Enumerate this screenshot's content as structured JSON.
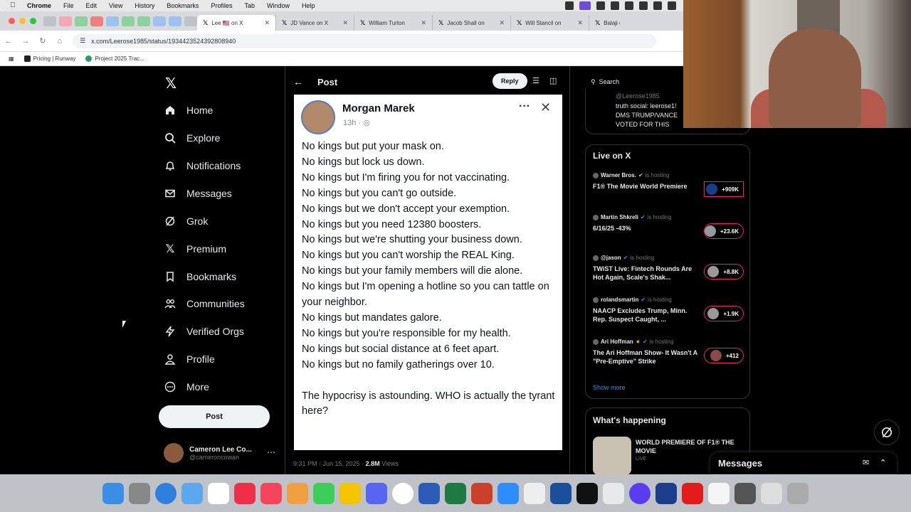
{
  "menubar": {
    "app": "Chrome",
    "items": [
      "File",
      "Edit",
      "View",
      "History",
      "Bookmarks",
      "Profiles",
      "Tab",
      "Window",
      "Help"
    ]
  },
  "tabs": [
    {
      "label": "Lee 🇺🇸 on X",
      "active": true
    },
    {
      "label": "JD Vance on X",
      "active": false
    },
    {
      "label": "William Turton",
      "active": false
    },
    {
      "label": "Jacob Shall on",
      "active": false
    },
    {
      "label": "Will Stancil on",
      "active": false
    },
    {
      "label": "Balaji on",
      "active": false
    }
  ],
  "address": {
    "url": "x.com/Leerose1985/status/1934423524392808940"
  },
  "bookmarks": [
    {
      "label": "Pricing | Runway",
      "color": "#222222"
    },
    {
      "label": "Project 2025 Trac...",
      "color": "#2e9e5b"
    }
  ],
  "nav": {
    "items": [
      {
        "label": "Home",
        "icon": "home-icon"
      },
      {
        "label": "Explore",
        "icon": "search-icon"
      },
      {
        "label": "Notifications",
        "icon": "bell-icon"
      },
      {
        "label": "Messages",
        "icon": "envelope-icon"
      },
      {
        "label": "Grok",
        "icon": "grok-icon"
      },
      {
        "label": "Premium",
        "icon": "x-icon"
      },
      {
        "label": "Bookmarks",
        "icon": "bookmark-icon"
      },
      {
        "label": "Communities",
        "icon": "people-icon"
      },
      {
        "label": "Verified Orgs",
        "icon": "lightning-icon"
      },
      {
        "label": "Profile",
        "icon": "person-icon"
      },
      {
        "label": "More",
        "icon": "more-circle-icon"
      }
    ],
    "post_label": "Post",
    "account": {
      "name": "Cameron Lee Co...",
      "handle": "@cameroncowan"
    }
  },
  "post": {
    "header_title": "Post",
    "reply_label": "Reply",
    "author": "Morgan Marek",
    "time": "13h",
    "lines": [
      "No kings but put your mask on.",
      "No kings but lock us down.",
      "No kings but I'm firing you for not vaccinating.",
      "No kings but you can't go outside.",
      "No kings but we don't accept your exemption.",
      "No kings but you need 12380 boosters.",
      "No kings but we're shutting your business down.",
      "No kings but you can't worship the REAL King.",
      "No kings but your family members will die alone.",
      "No kings but I'm opening a hotline so you can tattle on your neighbor.",
      "No kings but mandates galore.",
      "No kings but you're responsible for my health.",
      "No kings but social distance at 6 feet apart.",
      "No kings but no family gatherings over 10.",
      "",
      "The hypocrisy is astounding. WHO is actually the tyrant here?"
    ],
    "meta_date": "9:31 PM · Jun 15, 2025 ·",
    "meta_views": "2.8M",
    "meta_views_label": "Views"
  },
  "right": {
    "search_placeholder": "Search",
    "prev_handle": "@Leerose1985",
    "prev_lines": [
      "truth social: leerose1!",
      "DMS TRUMP/VANCE",
      "VOTED FOR THIS"
    ],
    "live_title": "Live on X",
    "is_hosting": "is hosting",
    "live_items": [
      {
        "host": "Warner Bros.",
        "title": "F1® The Movie World Premiere",
        "count": "+909K"
      },
      {
        "host": "Martin Shkreli",
        "title": "6/16/25 -43%",
        "count": "+23.6K"
      },
      {
        "host": "@jason",
        "title": "TWiST Live: Fintech Rounds Are Hot Again, Scale's Shak...",
        "count": "+8.8K"
      },
      {
        "host": "rolandsmartin",
        "title": "NAACP Excludes Trump, Minn. Rep. Suspect Caught, ...",
        "count": "+1.9K"
      },
      {
        "host": "Ari Hoffman",
        "title": "The Ari Hoffman Show- It Wasn't A \"Pre-Emptive\" Strike",
        "count": "+412"
      }
    ],
    "show_more": "Show more",
    "happening_title": "What's happening",
    "happening_item": "WORLD PREMIERE OF F1® THE MOVIE",
    "happening_tag": "LIVE",
    "messages_label": "Messages"
  },
  "colors": {
    "accent": "#1d9bf0",
    "live": "#f91880",
    "background": "#000000"
  }
}
